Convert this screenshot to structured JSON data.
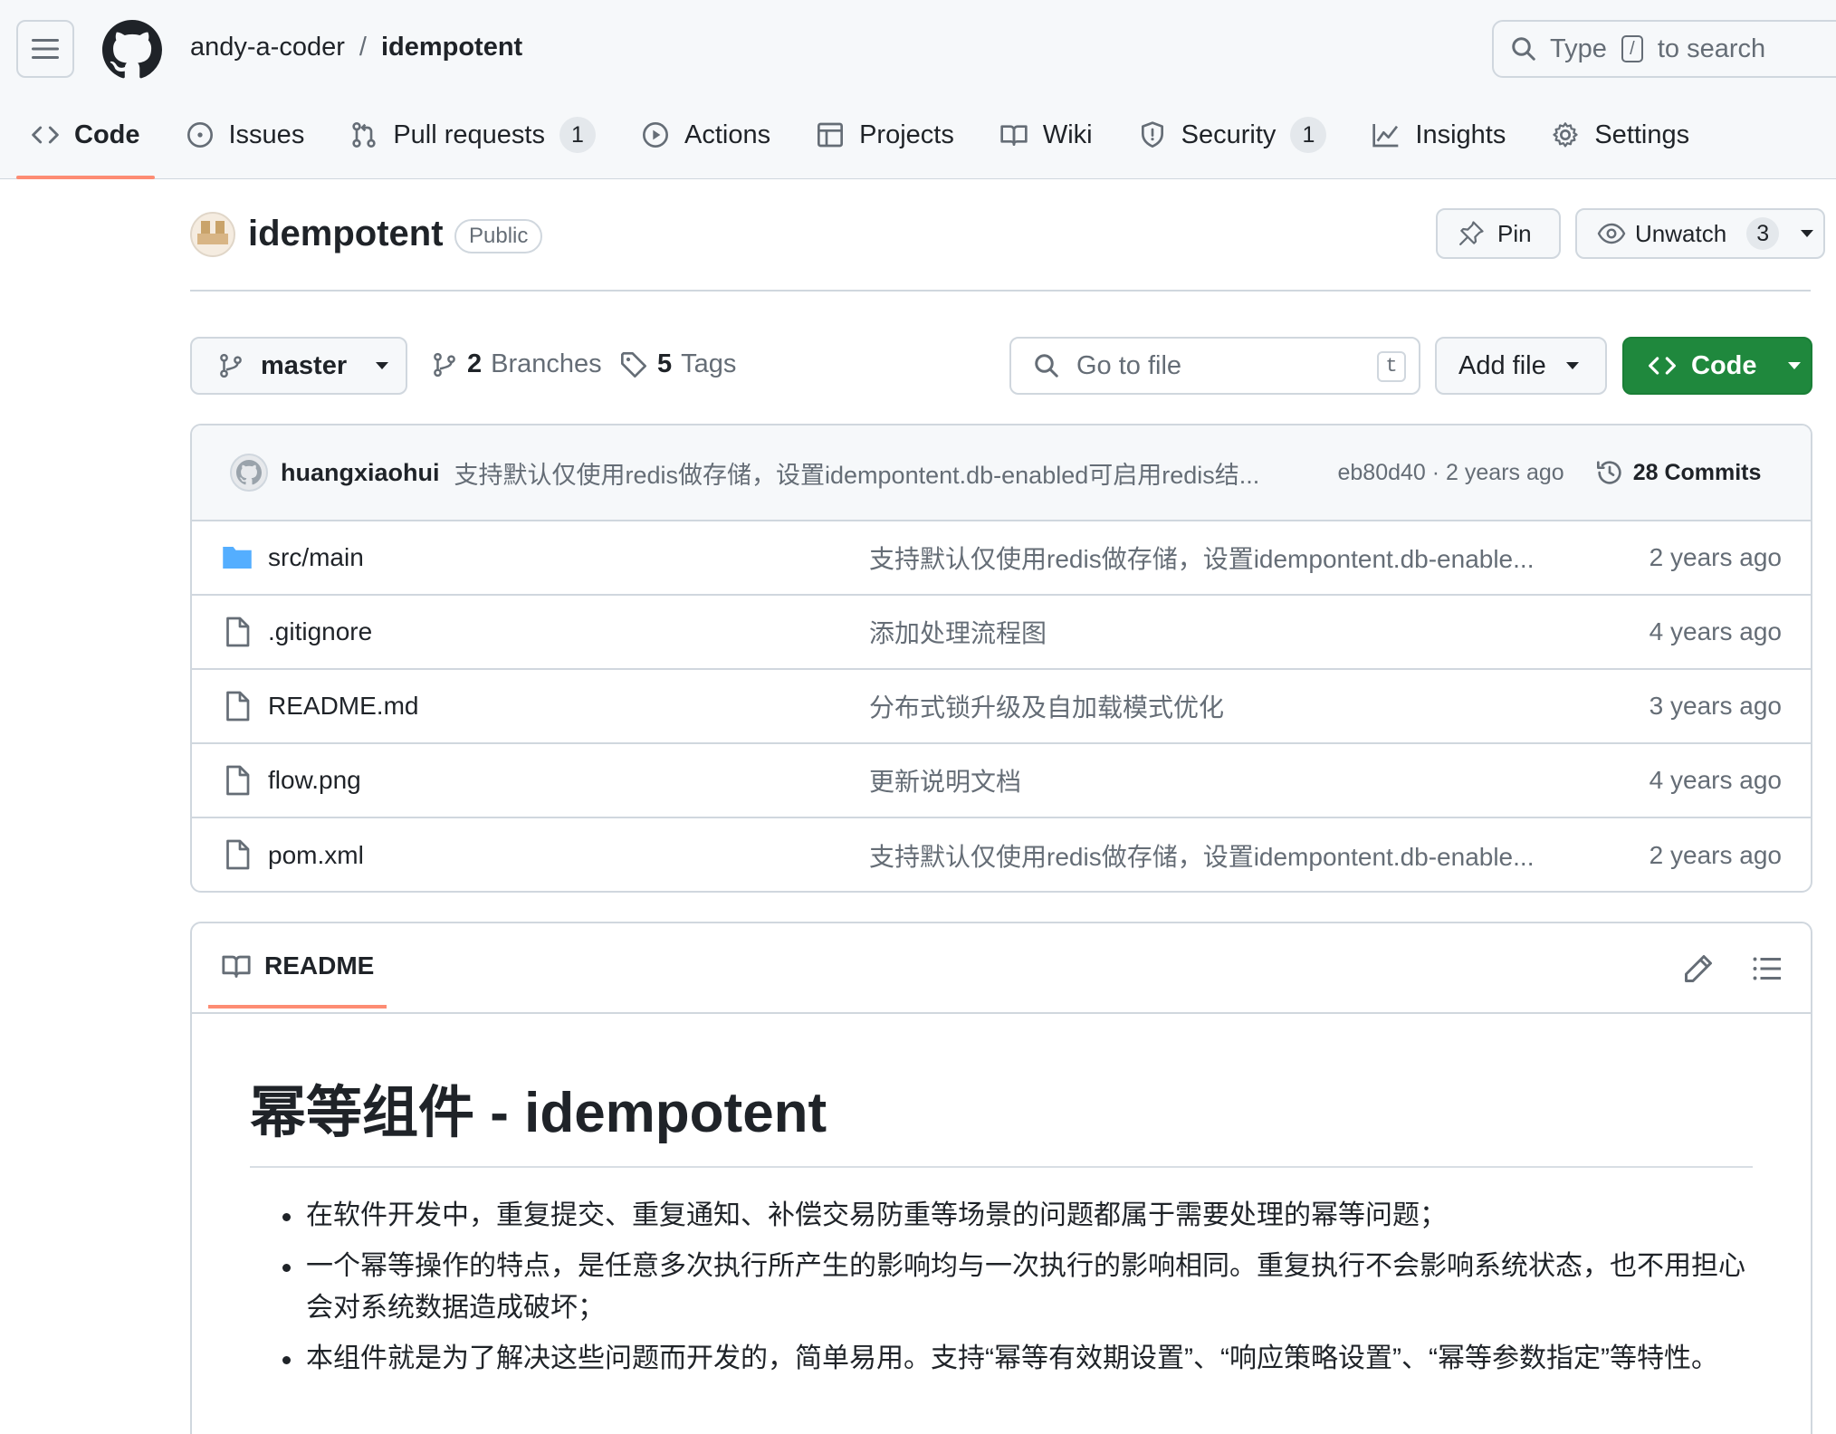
{
  "header": {
    "owner": "andy-a-coder",
    "separator": "/",
    "repo": "idempotent",
    "search": {
      "prefix": "Type",
      "key": "/",
      "suffix": "to search"
    }
  },
  "nav": {
    "tabs": [
      {
        "label": "Code",
        "icon": "code-icon"
      },
      {
        "label": "Issues",
        "icon": "issue-icon"
      },
      {
        "label": "Pull requests",
        "icon": "pull-request-icon",
        "count": "1"
      },
      {
        "label": "Actions",
        "icon": "play-icon"
      },
      {
        "label": "Projects",
        "icon": "table-icon"
      },
      {
        "label": "Wiki",
        "icon": "book-icon"
      },
      {
        "label": "Security",
        "icon": "shield-icon",
        "count": "1"
      },
      {
        "label": "Insights",
        "icon": "graph-icon"
      },
      {
        "label": "Settings",
        "icon": "gear-icon"
      }
    ],
    "active": "Code"
  },
  "repo_head": {
    "name": "idempotent",
    "visibility": "Public",
    "pin_label": "Pin",
    "watch_label": "Unwatch",
    "watch_count": "3"
  },
  "file_nav": {
    "branch": "master",
    "branches_count": "2",
    "branches_label": "Branches",
    "tags_count": "5",
    "tags_label": "Tags",
    "goto_placeholder": "Go to file",
    "goto_key": "t",
    "add_file_label": "Add file",
    "code_label": "Code"
  },
  "latest_commit": {
    "author": "huangxiaohui",
    "message": "支持默认仅使用redis做存储，设置idempontent.db-enabled可启用redis结...",
    "hash_time": "eb80d40 · 2 years ago",
    "commits_label": "28 Commits"
  },
  "files": [
    {
      "name": "src/main",
      "type": "folder",
      "message": "支持默认仅使用redis做存储，设置idempontent.db-enable...",
      "date": "2 years ago"
    },
    {
      "name": ".gitignore",
      "type": "file",
      "message": "添加处理流程图",
      "date": "4 years ago"
    },
    {
      "name": "README.md",
      "type": "file",
      "message": "分布式锁升级及自加载模式优化",
      "date": "3 years ago"
    },
    {
      "name": "flow.png",
      "type": "file",
      "message": "更新说明文档",
      "date": "4 years ago"
    },
    {
      "name": "pom.xml",
      "type": "file",
      "message": "支持默认仅使用redis做存储，设置idempontent.db-enable...",
      "date": "2 years ago"
    }
  ],
  "readme": {
    "tab_label": "README",
    "title": "幂等组件 - idempotent",
    "bullets": [
      "在软件开发中，重复提交、重复通知、补偿交易防重等场景的问题都属于需要处理的幂等问题；",
      "一个幂等操作的特点，是任意多次执行所产生的影响均与一次执行的影响相同。重复执行不会影响系统状态，也不用担心会对系统数据造成破坏；",
      "本组件就是为了解决这些问题而开发的，简单易用。支持“幂等有效期设置”、“响应策略设置”、“幂等参数指定”等特性。"
    ]
  },
  "colors": {
    "accent_underline": "#fd8c73",
    "primary_button": "#1f883d",
    "folder": "#54aeff",
    "muted_text": "#656d76",
    "border": "#d0d7de"
  }
}
